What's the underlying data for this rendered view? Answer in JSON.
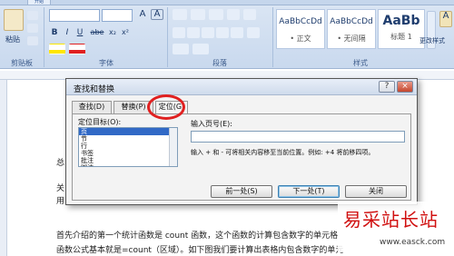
{
  "ribbon": {
    "tabs": [
      "开始"
    ],
    "paste_label": "粘贴",
    "group_clipboard": "剪贴板",
    "group_font": "字体",
    "group_paragraph": "段落",
    "group_styles": "样式",
    "font_buttons": [
      "B",
      "I",
      "U",
      "abe",
      "x₂",
      "x²",
      "A"
    ],
    "style_items": [
      {
        "sample": "AaBbCcDd",
        "name": "• 正文"
      },
      {
        "sample": "AaBbCcDd",
        "name": "• 无间隔"
      },
      {
        "sample": "AaBb",
        "name": "标题 1"
      }
    ],
    "change_styles_label": "更改样式"
  },
  "document": {
    "line_fragment_1": "总",
    "line_fragment_2": "关",
    "line_fragment_3": "用",
    "para_line_1": "首先介绍的第一个统计函数是 count 函数，这个函数的计算包含数字的单元格",
    "para_line_2": "函数公式基本就是=count（区域）。如下图我们要计算出表格内包含数字的单元"
  },
  "dialog": {
    "title": "查找和替换",
    "help_label": "?",
    "close_label": "×",
    "tabs": [
      "查找(D)",
      "替换(P)",
      "定位(G)"
    ],
    "goto_what_label": "定位目标(O):",
    "goto_items": [
      "页",
      "节",
      "行",
      "书签",
      "批注",
      "脚注"
    ],
    "enter_page_label": "输入页号(E):",
    "page_input_value": "",
    "hint_text": "输入 + 和 - 可将相关内容移至当前位置。例如: +4 将前移四项。",
    "prev_button": "前一处(S)",
    "next_button": "下一处(T)",
    "close_button": "关闭"
  },
  "watermark": {
    "title": "易采站长站",
    "url": "www.easck.com"
  },
  "colors": {
    "highlight_circle": "#e02020",
    "watermark_red": "#d01010"
  }
}
